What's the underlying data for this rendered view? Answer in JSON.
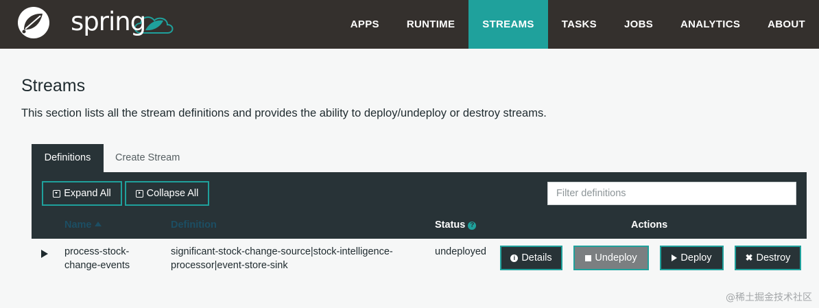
{
  "brand": {
    "name": "spring"
  },
  "nav": {
    "items": [
      {
        "label": "APPS",
        "active": false
      },
      {
        "label": "RUNTIME",
        "active": false
      },
      {
        "label": "STREAMS",
        "active": true
      },
      {
        "label": "TASKS",
        "active": false
      },
      {
        "label": "JOBS",
        "active": false
      },
      {
        "label": "ANALYTICS",
        "active": false
      },
      {
        "label": "ABOUT",
        "active": false
      }
    ]
  },
  "page": {
    "title": "Streams",
    "description": "This section lists all the stream definitions and provides the ability to deploy/undeploy or destroy streams."
  },
  "tabs": [
    {
      "label": "Definitions",
      "active": true
    },
    {
      "label": "Create Stream",
      "active": false
    }
  ],
  "toolbar": {
    "expand_all": "Expand All",
    "collapse_all": "Collapse All",
    "filter_placeholder": "Filter definitions",
    "filter_value": ""
  },
  "table": {
    "headers": {
      "name": "Name",
      "definition": "Definition",
      "status": "Status",
      "actions": "Actions"
    },
    "rows": [
      {
        "name": "process-stock-change-events",
        "definition": "significant-stock-change-source|stock-intelligence-processor|event-store-sink",
        "status": "undeployed",
        "actions": {
          "details": "Details",
          "undeploy": "Undeploy",
          "deploy": "Deploy",
          "destroy": "Destroy"
        }
      }
    ]
  },
  "icons": {
    "sort": "sort-ascending-icon",
    "help": "help-circle-icon",
    "expand": "expand-square-icon",
    "collapse": "collapse-square-icon",
    "toggle": "row-expand-icon",
    "details": "info-icon",
    "undeploy": "stop-icon",
    "deploy": "play-icon",
    "destroy": "close-icon"
  },
  "colors": {
    "navbar": "#34302d",
    "accent": "#1fa19c",
    "panel": "#283337",
    "header_link": "#1c4e63",
    "page_bg": "#f6f7f7"
  },
  "watermark": "@稀土掘金技术社区"
}
